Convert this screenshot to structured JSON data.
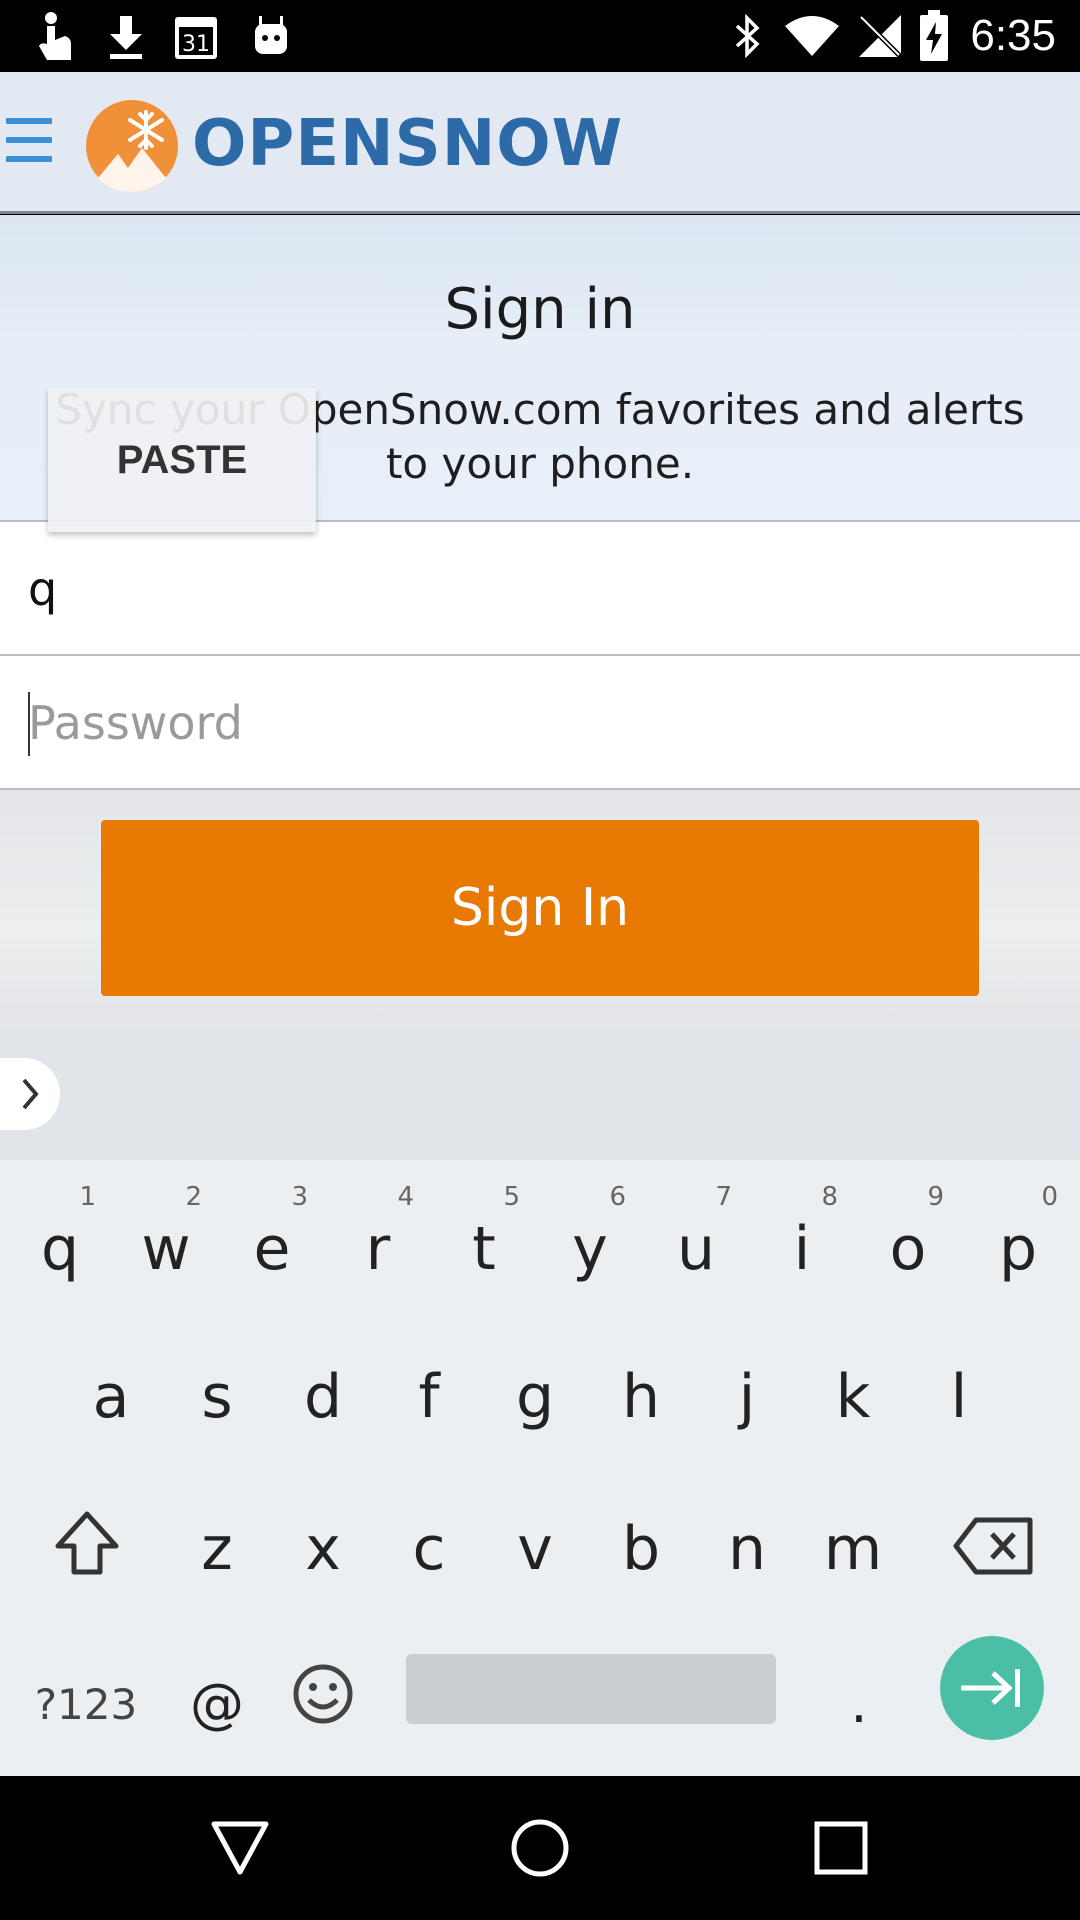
{
  "status_bar": {
    "time": "6:35",
    "icons": [
      "touch-icon",
      "download-icon",
      "calendar-icon",
      "android-icon",
      "bluetooth-icon",
      "wifi-icon",
      "no-signal-icon",
      "battery-charging-icon"
    ],
    "calendar_day": "31"
  },
  "header": {
    "logo_text": "OPENSNOW",
    "brand_color": "#2c6aa8",
    "logo_color": "#f0913a"
  },
  "signin": {
    "title": "Sign in",
    "subtitle": "Sync your OpenSnow.com favorites and alerts to your phone."
  },
  "context_menu": {
    "paste_label": "PASTE"
  },
  "form": {
    "username_value": "q",
    "password_placeholder": "Password",
    "submit_label": "Sign In",
    "button_color": "#e87a03"
  },
  "keyboard": {
    "row1": [
      {
        "label": "q",
        "hint": "1"
      },
      {
        "label": "w",
        "hint": "2"
      },
      {
        "label": "e",
        "hint": "3"
      },
      {
        "label": "r",
        "hint": "4"
      },
      {
        "label": "t",
        "hint": "5"
      },
      {
        "label": "y",
        "hint": "6"
      },
      {
        "label": "u",
        "hint": "7"
      },
      {
        "label": "i",
        "hint": "8"
      },
      {
        "label": "o",
        "hint": "9"
      },
      {
        "label": "p",
        "hint": "0"
      }
    ],
    "row2": [
      "a",
      "s",
      "d",
      "f",
      "g",
      "h",
      "j",
      "k",
      "l"
    ],
    "row3": [
      "z",
      "x",
      "c",
      "v",
      "b",
      "n",
      "m"
    ],
    "symbols_label": "?123",
    "at_label": "@",
    "period_label": ".",
    "action_color": "#4bbfa6"
  }
}
